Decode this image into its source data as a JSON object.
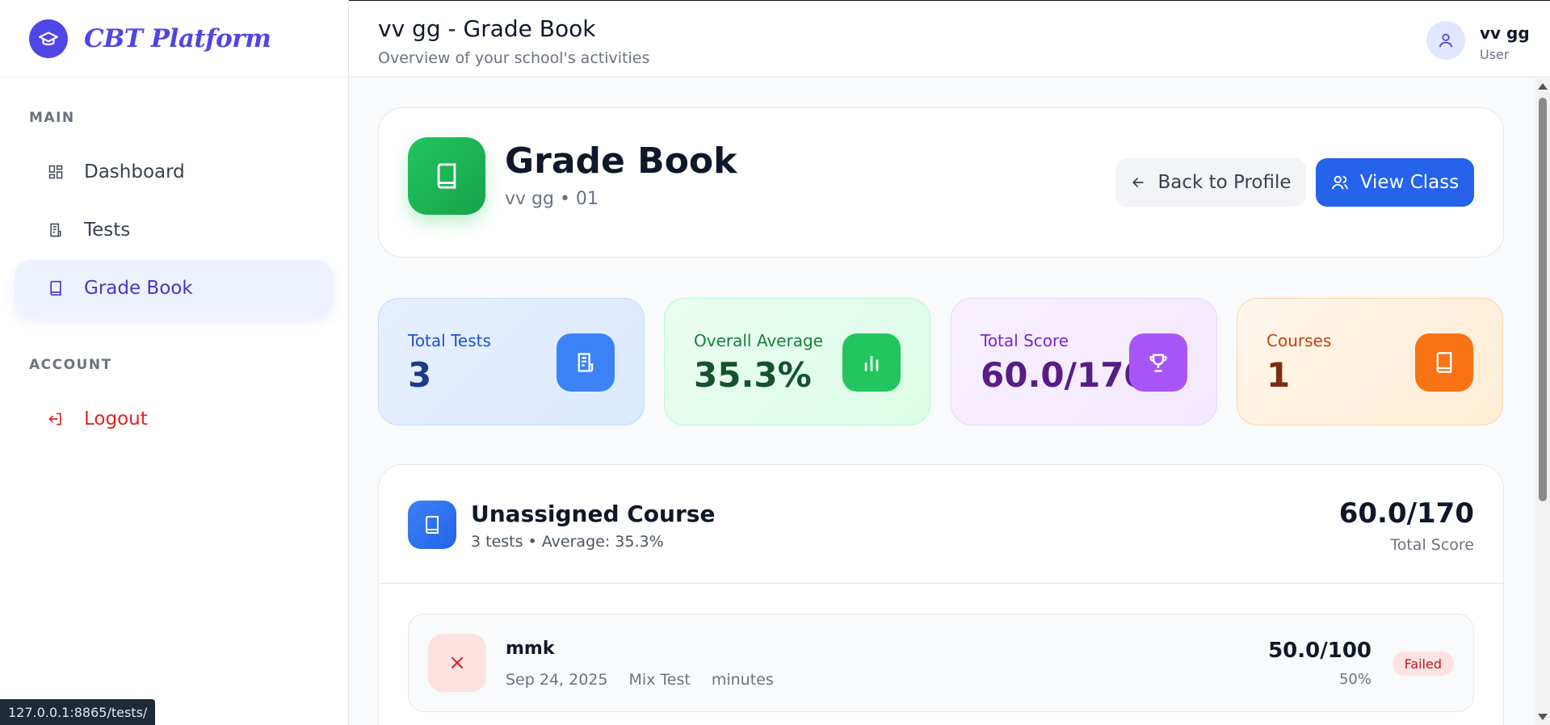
{
  "brand": {
    "name": "CBT Platform"
  },
  "sidebar": {
    "main_label": "MAIN",
    "account_label": "ACCOUNT",
    "items": [
      {
        "label": "Dashboard",
        "icon": "dashboard-icon"
      },
      {
        "label": "Tests",
        "icon": "tests-icon"
      },
      {
        "label": "Grade Book",
        "icon": "book-icon"
      }
    ],
    "logout_label": "Logout"
  },
  "header": {
    "title": "vv gg - Grade Book",
    "subtitle": "Overview of your school's activities",
    "user_name": "vv gg",
    "user_role": "User"
  },
  "gradebook": {
    "title": "Grade Book",
    "subtitle": "vv gg • 01",
    "back_label": "Back to Profile",
    "view_class_label": "View Class"
  },
  "stats": [
    {
      "label": "Total Tests",
      "value": "3"
    },
    {
      "label": "Overall Average",
      "value": "35.3%"
    },
    {
      "label": "Total Score",
      "value": "60.0/170"
    },
    {
      "label": "Courses",
      "value": "1"
    }
  ],
  "course": {
    "title": "Unassigned Course",
    "subtitle": "3 tests • Average: 35.3%",
    "score": "60.0/170",
    "score_label": "Total Score",
    "tests": [
      {
        "name": "mmk",
        "date": "Sep 24, 2025",
        "type": "Mix Test",
        "duration": "minutes",
        "score": "50.0/100",
        "percent": "50%",
        "status": "Failed",
        "status_icon": "×"
      }
    ]
  },
  "status_bar": {
    "url": "127.0.0.1:8865/tests/"
  },
  "colors": {
    "accent": "#4f46e5",
    "primary_button": "#2563eb",
    "danger": "#dc2626"
  }
}
